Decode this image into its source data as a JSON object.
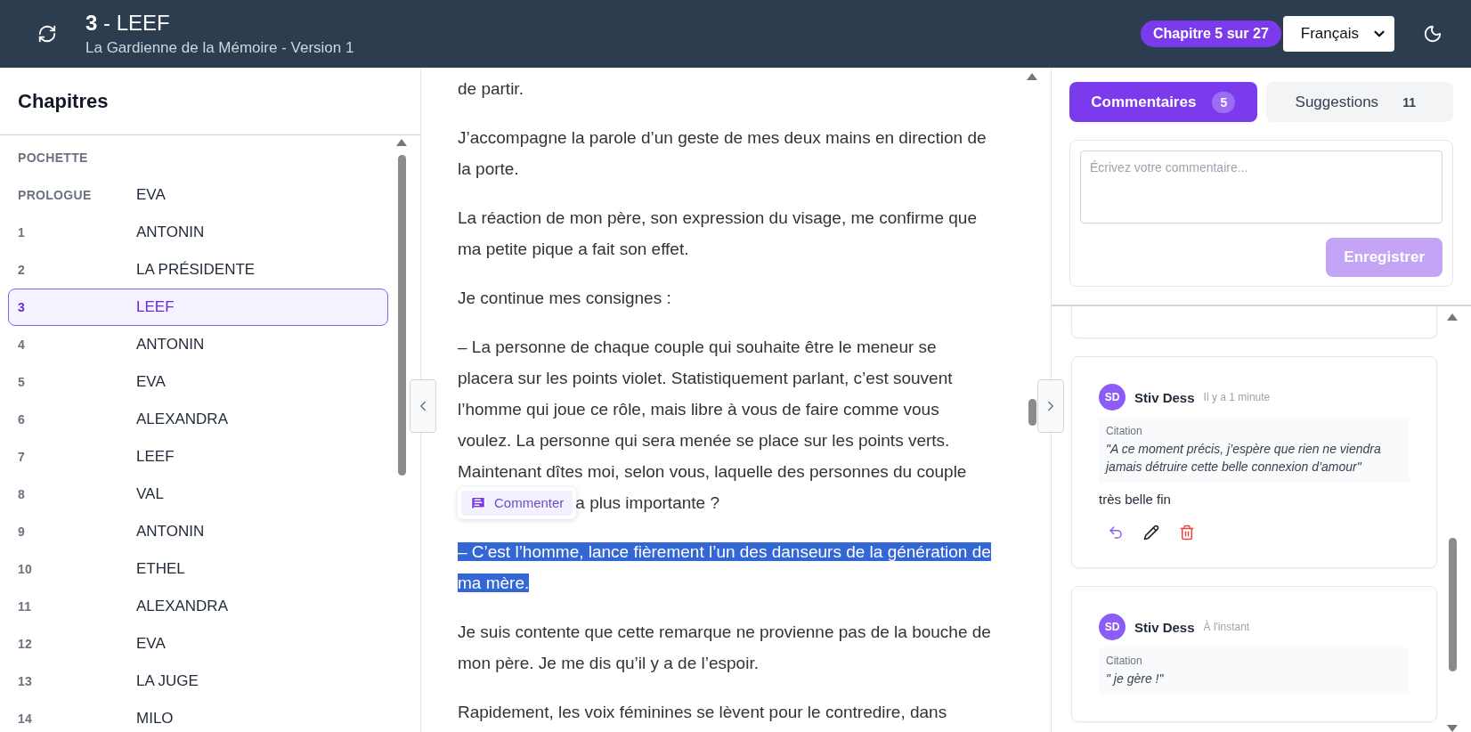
{
  "header": {
    "title": "**3** - LEEF",
    "subtitle": "La Gardienne de la Mémoire - Version 1",
    "chapter_badge": "Chapitre 5 sur 27",
    "language": "Français"
  },
  "sidebar": {
    "title": "Chapitres",
    "chapters": [
      {
        "number": "POCHETTE",
        "selected": false
      },
      {
        "number": "PROLOGUE",
        "name": "EVA",
        "selected": false
      },
      {
        "number": "1",
        "name": "ANTONIN",
        "selected": false
      },
      {
        "number": "2",
        "name": "LA PRÉSIDENTE",
        "selected": false
      },
      {
        "number": "3",
        "name": "LEEF",
        "selected": true
      },
      {
        "number": "4",
        "name": "ANTONIN",
        "selected": false
      },
      {
        "number": "5",
        "name": "EVA",
        "selected": false
      },
      {
        "number": "6",
        "name": "ALEXANDRA",
        "selected": false
      },
      {
        "number": "7",
        "name": "LEEF",
        "selected": false
      },
      {
        "number": "8",
        "name": "VAL",
        "selected": false
      },
      {
        "number": "9",
        "name": "ANTONIN",
        "selected": false
      },
      {
        "number": "10",
        "name": "ETHEL",
        "selected": false
      },
      {
        "number": "11",
        "name": "ALEXANDRA",
        "selected": false
      },
      {
        "number": "12",
        "name": "EVA",
        "selected": false
      },
      {
        "number": "13",
        "name": "LA JUGE",
        "selected": false
      },
      {
        "number": "14",
        "name": "MILO",
        "selected": false
      }
    ]
  },
  "reader": {
    "paragraphs": [
      {
        "text": "de partir.",
        "highlighted": false
      },
      {
        "text": "J’accompagne la parole d’un geste de mes deux mains en direction de la porte.",
        "highlighted": false
      },
      {
        "text": "La réaction de mon père, son expression du visage, me confirme que ma petite pique a fait son effet.",
        "highlighted": false
      },
      {
        "text": "Je continue mes consignes :",
        "highlighted": false
      },
      {
        "text": "– La personne de chaque couple qui souhaite être le meneur se placera sur les points violet. Statistiquement parlant, c’est souvent l’homme qui joue ce rôle, mais libre à vous de faire comme vous voulez. La personne qui sera menée se place sur les points verts. Maintenant dîtes moi, selon vous, laquelle des personnes du couple",
        "highlighted": false,
        "continuation": "a plus importante ?"
      },
      {
        "text": "– C’est l’homme, lance fièrement l’un des danseurs de la génération de ma mère.",
        "highlighted": true
      },
      {
        "text": "Je suis contente que cette remarque ne provienne pas de la bouche de mon père. Je me dis qu’il y a de l’espoir.",
        "highlighted": false
      },
      {
        "text": "Rapidement, les voix féminines se lèvent pour le contredire, dans",
        "highlighted": false
      }
    ],
    "comment_popup": {
      "label": "Commenter"
    }
  },
  "panel": {
    "tabs": [
      {
        "label": "Commentaires",
        "count": "5",
        "selected": true
      },
      {
        "label": "Suggestions",
        "count": "11",
        "selected": false
      }
    ],
    "form": {
      "placeholder": "Écrivez votre commentaire...",
      "button": "Enregistrer",
      "disabled": true
    },
    "comments": [
      {
        "initials": "SD",
        "author": "Stiv Dess",
        "time": "Il y a 1 minute",
        "quote_label": "Citation",
        "quote": "\"A ce moment précis, j’espère que rien ne viendra jamais détruire cette belle connexion d’amour\"",
        "text": "très belle fin"
      },
      {
        "initials": "SD",
        "author": "Stiv Dess",
        "time": "À l'instant",
        "quote_label": "Citation",
        "quote": "\" je gère !\""
      }
    ]
  }
}
